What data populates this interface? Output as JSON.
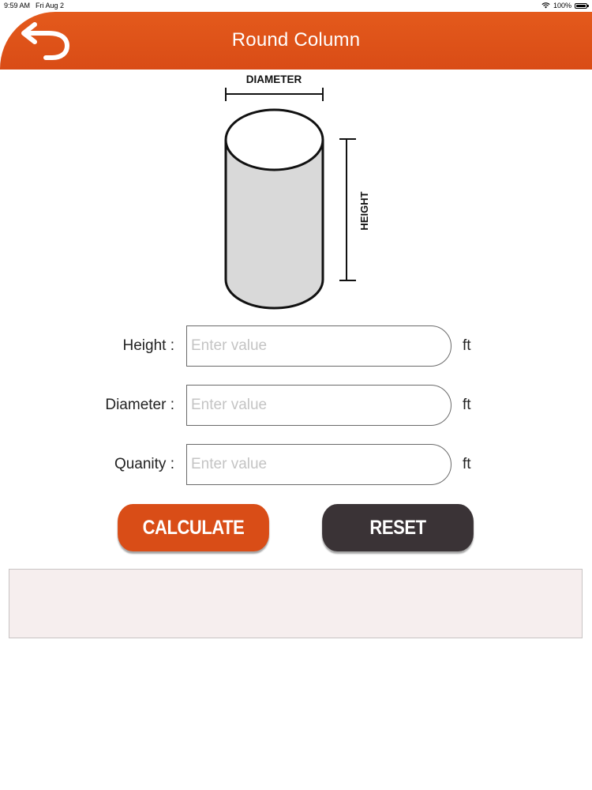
{
  "status_bar": {
    "time": "9:59 AM",
    "date": "Fri Aug 2",
    "battery": "100%",
    "icons": [
      "wifi-icon",
      "battery-icon"
    ]
  },
  "header": {
    "title": "Round Column",
    "back_icon": "back-arrow-icon",
    "color": "#d94c16"
  },
  "diagram": {
    "diameter_label": "DIAMETER",
    "height_label": "HEIGHT"
  },
  "form": {
    "fields": [
      {
        "label": "Height :",
        "placeholder": "Enter value",
        "value": "",
        "unit": "ft"
      },
      {
        "label": "Diameter :",
        "placeholder": "Enter value",
        "value": "",
        "unit": "ft"
      },
      {
        "label": "Quanity :",
        "placeholder": "Enter value",
        "value": "",
        "unit": "ft"
      }
    ]
  },
  "buttons": {
    "calculate": "CALCULATE",
    "reset": "RESET",
    "calculate_color": "#d94d17",
    "reset_color": "#3a3336"
  },
  "result": {
    "text": ""
  }
}
